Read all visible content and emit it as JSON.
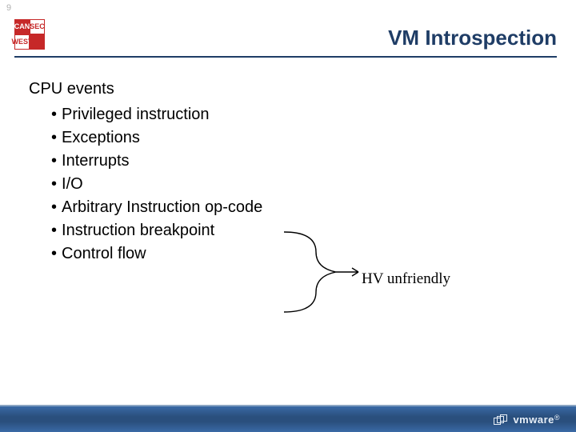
{
  "page_number": "9",
  "logo_cells": {
    "c1": "CAN",
    "c2": "SEC",
    "c3": "WEST"
  },
  "title": "VM Introspection",
  "heading": "CPU events",
  "bullets": [
    "Privileged instruction",
    "Exceptions",
    "Interrupts",
    "I/O",
    "Arbitrary Instruction op-code",
    "Instruction breakpoint",
    "Control flow"
  ],
  "annotation": "HV unfriendly",
  "footer_brand": "vmware",
  "footer_reg": "®"
}
